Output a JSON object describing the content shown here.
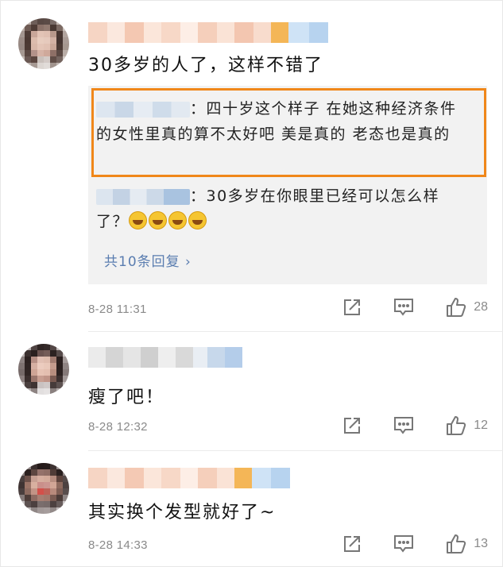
{
  "comments": [
    {
      "text": "30多岁的人了，这样不错了",
      "replies": [
        {
          "text": "：四十岁这个样子 在她这种经济条件的女性里真的算不太好吧 美是真的 老态也是真的"
        },
        {
          "text": "：30多岁在你眼里已经可以怎么样了？"
        }
      ],
      "more_replies": "共10条回复 ›",
      "time": "8-28 11:31",
      "likes": "28"
    },
    {
      "text": "瘦了吧！",
      "time": "8-28 12:32",
      "likes": "12"
    },
    {
      "text": "其实换个发型就好了~",
      "time": "8-28 14:33",
      "likes": "13"
    }
  ],
  "icons": {
    "share": "share-icon",
    "comment": "comment-icon",
    "like": "thumbs-up-icon"
  },
  "colors": {
    "highlight_border": "#f0871a",
    "link": "#5a7db0",
    "meta": "#8a8a8a"
  }
}
